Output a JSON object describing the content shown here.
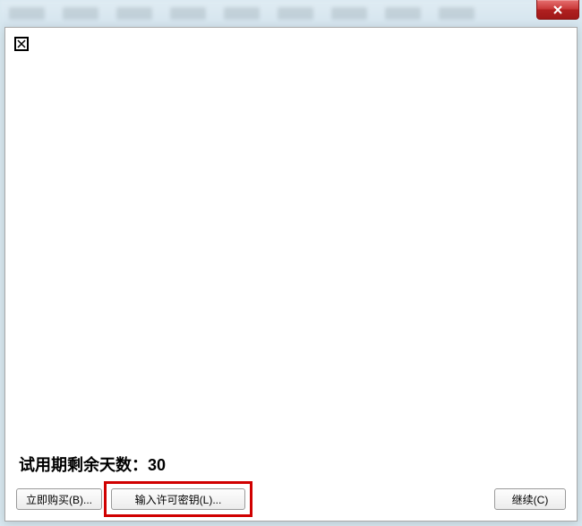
{
  "background": {
    "menu_items_count": 9
  },
  "titlebar": {
    "close_icon": "close"
  },
  "dialog": {
    "broken_icon": "missing-image",
    "trial_message": "试用期剩余天数：30",
    "buttons": {
      "buy_now": "立即购买(B)...",
      "enter_license": "输入许可密钥(L)...",
      "continue": "继续(C)"
    }
  },
  "highlight": {
    "target": "enter-license-button"
  }
}
